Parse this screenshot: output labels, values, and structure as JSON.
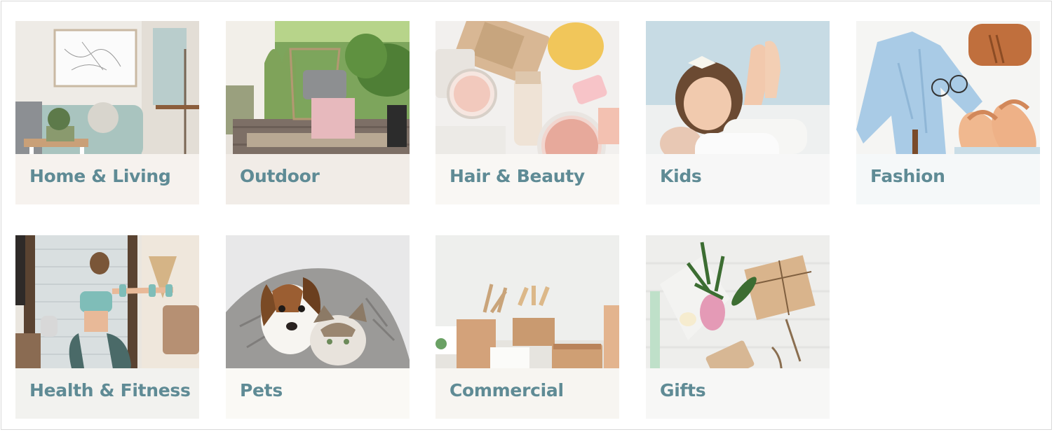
{
  "categories": [
    {
      "label": "Home & Living"
    },
    {
      "label": "Outdoor"
    },
    {
      "label": "Hair & Beauty"
    },
    {
      "label": "Kids"
    },
    {
      "label": "Fashion"
    },
    {
      "label": "Health & Fitness"
    },
    {
      "label": "Pets"
    },
    {
      "label": "Commercial"
    },
    {
      "label": "Gifts"
    }
  ],
  "colors": {
    "label": "#5f8b95",
    "border": "#d9d9d9",
    "overlay": "rgba(255,255,255,0.62)"
  }
}
